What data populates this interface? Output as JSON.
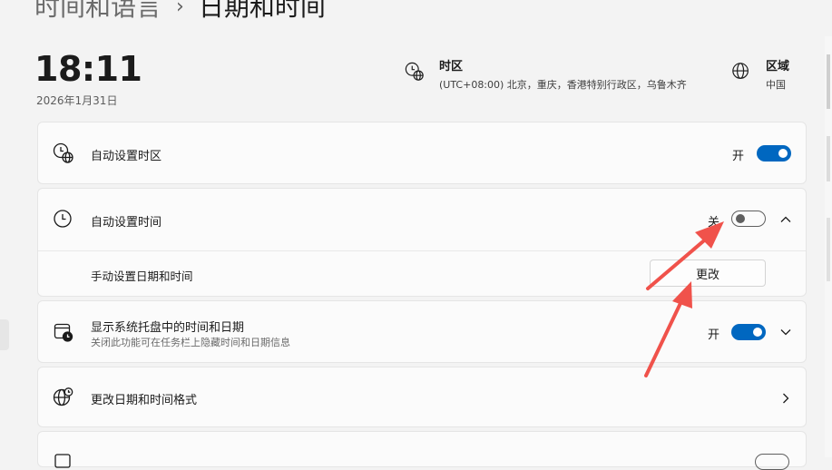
{
  "breadcrumb": {
    "parent": "时间和语言",
    "separator": "›",
    "current": "日期和时间"
  },
  "clock": {
    "time": "18:11",
    "date": "2026年1月31日"
  },
  "timezone_info": {
    "icon": "timezone-icon",
    "title": "时区",
    "value": "(UTC+08:00) 北京，重庆，香港特别行政区，乌鲁木齐"
  },
  "region_info": {
    "icon": "globe-icon",
    "title": "区域",
    "value": "中国"
  },
  "settings": {
    "auto_timezone": {
      "icon": "timezone-icon",
      "label": "自动设置时区",
      "state": "开",
      "on": true
    },
    "auto_time": {
      "icon": "clock-icon",
      "label": "自动设置时间",
      "state": "关",
      "on": false,
      "expanded": true
    },
    "manual_set": {
      "label": "手动设置日期和时间",
      "button": "更改"
    },
    "show_tray": {
      "icon": "calendar-clock-icon",
      "label": "显示系统托盘中的时间和日期",
      "sublabel": "关闭此功能可在任务栏上隐藏时间和日期信息",
      "state": "开",
      "on": true
    },
    "format": {
      "icon": "globe-format-icon",
      "label": "更改日期和时间格式"
    }
  },
  "colors": {
    "accent": "#0067c0",
    "arrow": "#f0524b",
    "background": "#f3f3f3",
    "card": "#fbfbfb"
  }
}
